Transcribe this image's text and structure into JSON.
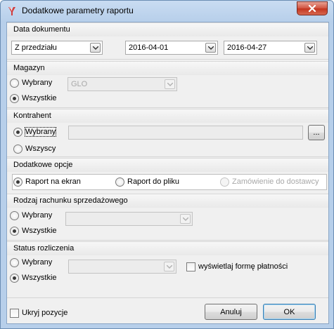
{
  "window": {
    "title": "Dodatkowe parametry raportu",
    "close_symbol": "close-icon"
  },
  "data_dokumentu": {
    "heading": "Data dokumentu",
    "range_type": "Z przedziału",
    "date_from": "2016-04-01",
    "date_to": "2016-04-27"
  },
  "magazyn": {
    "heading": "Magazyn",
    "option_selected": "Wybrany",
    "option_all": "Wszystkie",
    "value": "GLO",
    "selected": "Wszystkie"
  },
  "kontrahent": {
    "heading": "Kontrahent",
    "option_selected": "Wybrany",
    "option_all": "Wszyscy",
    "value": "",
    "browse_label": "...",
    "selected": "Wybrany"
  },
  "opcje": {
    "heading": "Dodatkowe opcje",
    "screen_label": "Raport na ekran",
    "file_label": "Raport do pliku",
    "order_label": "Zamówienie do dostawcy",
    "selected": "Raport na ekran"
  },
  "rachunek": {
    "heading": "Rodzaj rachunku sprzedażowego",
    "option_selected": "Wybrany",
    "option_all": "Wszystkie",
    "value": "",
    "selected": "Wszystkie"
  },
  "status": {
    "heading": "Status rozliczenia",
    "option_selected": "Wybrany",
    "option_all": "Wszystkie",
    "value": "",
    "show_payment_label": "wyświetlaj formę płatności",
    "show_payment_checked": false,
    "selected": "Wszystkie"
  },
  "footer": {
    "hide_positions_label": "Ukryj pozycje",
    "hide_positions_checked": false,
    "cancel_label": "Anuluj",
    "ok_label": "OK"
  },
  "colors": {
    "title_bar": "#b7cfea",
    "close_button": "#c3341f",
    "client_bg": "#f0f0f0"
  }
}
